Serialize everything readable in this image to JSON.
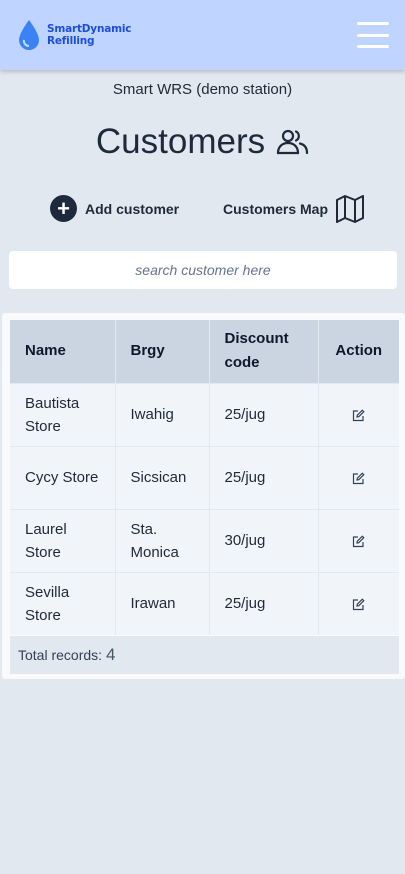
{
  "header": {
    "logo_line1": "SmartDynamic",
    "logo_line2": "Refilling",
    "brand_color": "#1d4ed8",
    "menu_icon": "hamburger-menu-icon"
  },
  "station": "Smart WRS (demo station)",
  "page": {
    "title": "Customers",
    "title_icon": "users-icon"
  },
  "actions": {
    "add_label": "Add customer",
    "add_icon": "plus-circle-icon",
    "map_label": "Customers Map",
    "map_icon": "map-icon"
  },
  "search": {
    "placeholder": "search customer here",
    "value": ""
  },
  "table": {
    "headers": {
      "name": "Name",
      "brgy": "Brgy",
      "discount": "Discount code",
      "action": "Action"
    },
    "rows": [
      {
        "name": "Bautista Store",
        "brgy": "Iwahig",
        "discount": "25/jug"
      },
      {
        "name": "Cycy Store",
        "brgy": "Sicsican",
        "discount": "25/jug"
      },
      {
        "name": "Laurel Store",
        "brgy": "Sta. Monica",
        "discount": "30/jug"
      },
      {
        "name": "Sevilla Store",
        "brgy": "Irawan",
        "discount": "25/jug"
      }
    ],
    "row_action_icon": "edit-icon",
    "total_label": "Total records:",
    "total_count": "4"
  }
}
